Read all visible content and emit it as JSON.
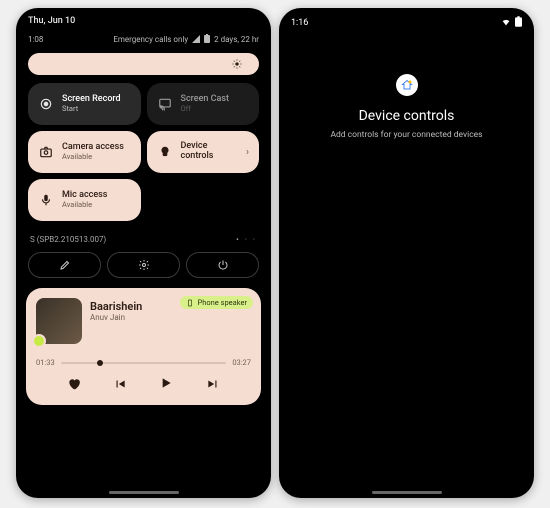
{
  "left": {
    "date": "Thu, Jun 10",
    "clock": "1:08",
    "emergency": "Emergency calls only",
    "battery_time": "2 days, 22 hr",
    "tiles": {
      "screen_record": {
        "title": "Screen Record",
        "sub": "Start"
      },
      "screen_cast": {
        "title": "Screen Cast",
        "sub": "Off"
      },
      "camera": {
        "title": "Camera access",
        "sub": "Available"
      },
      "device_ctrl": {
        "title": "Device controls"
      },
      "mic": {
        "title": "Mic access",
        "sub": "Available"
      }
    },
    "build": "S (SPB2.210513.007)",
    "media": {
      "title": "Baarishein",
      "artist": "Anuv Jain",
      "output": "Phone speaker",
      "elapsed": "01:33",
      "total": "03:27"
    }
  },
  "right": {
    "clock": "1:16",
    "title": "Device controls",
    "sub": "Add controls for your connected devices"
  }
}
